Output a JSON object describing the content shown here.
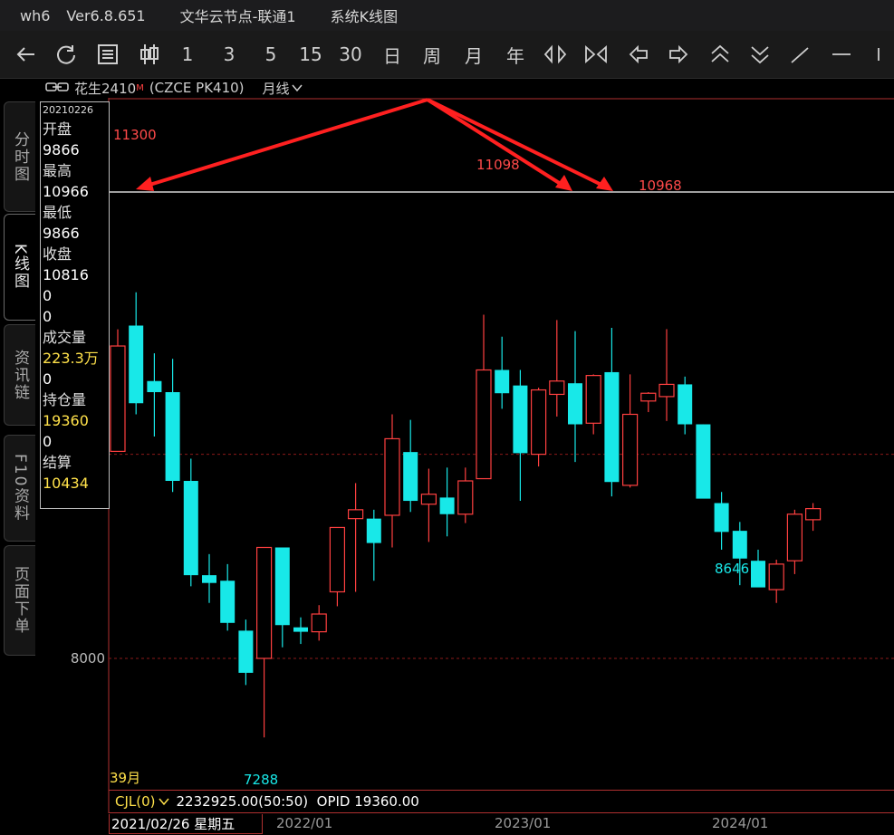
{
  "titlebar": {
    "app": "wh6",
    "version": "Ver6.8.651",
    "server": "文华云节点-联通1",
    "window": "系统K线图"
  },
  "toolbar": {
    "numbers": [
      "1",
      "3",
      "5",
      "15",
      "30"
    ],
    "periods": [
      "日",
      "周",
      "月",
      "年"
    ]
  },
  "instrument": {
    "name": "花生2410",
    "badge": "M",
    "code": "(CZCE PK410)",
    "period": "月线"
  },
  "side_tabs": [
    "分时图",
    "K线图",
    "资讯链",
    "F10资料",
    "页面下单"
  ],
  "data_panel": {
    "date": "20210226",
    "open_label": "开盘",
    "open": "9866",
    "high_label": "最高",
    "high": "10966",
    "low_label": "最低",
    "low": "9866",
    "close_label": "收盘",
    "close": "10816",
    "extra1": "0",
    "extra2": "0",
    "volume_label": "成交量",
    "volume": "223.3万",
    "volume_extra": "0",
    "oi_label": "持仓量",
    "oi": "19360",
    "oi_extra": "0",
    "settle_label": "结算",
    "settle": "10434"
  },
  "chart_data": {
    "type": "candlestick",
    "y_axis_label": "8000",
    "annotations": [
      "11300",
      "11098",
      "10968",
      "8646",
      "7288"
    ],
    "bar_count_label": "39月",
    "x_ticks": [
      "2022/01",
      "2023/01",
      "2024/01"
    ],
    "colors": {
      "up": "#ff4040",
      "down": "#18e8e8",
      "grid": "#8b1a1a",
      "ref": "#ffffff"
    },
    "candles": [
      {
        "o": 9866,
        "h": 10966,
        "l": 9866,
        "c": 10816
      },
      {
        "o": 11000,
        "h": 11300,
        "l": 10200,
        "c": 10300
      },
      {
        "o": 10500,
        "h": 10750,
        "l": 10000,
        "c": 10400
      },
      {
        "o": 10400,
        "h": 10700,
        "l": 9500,
        "c": 9600
      },
      {
        "o": 9600,
        "h": 9800,
        "l": 8650,
        "c": 8750
      },
      {
        "o": 8750,
        "h": 8940,
        "l": 8500,
        "c": 8680
      },
      {
        "o": 8700,
        "h": 8850,
        "l": 8250,
        "c": 8320
      },
      {
        "o": 8250,
        "h": 8350,
        "l": 7760,
        "c": 7870
      },
      {
        "o": 8000,
        "h": 9000,
        "l": 7288,
        "c": 9000
      },
      {
        "o": 9000,
        "h": 9000,
        "l": 8100,
        "c": 8300
      },
      {
        "o": 8280,
        "h": 8370,
        "l": 8130,
        "c": 8240
      },
      {
        "o": 8240,
        "h": 8480,
        "l": 8160,
        "c": 8400
      },
      {
        "o": 8600,
        "h": 9180,
        "l": 8470,
        "c": 9180
      },
      {
        "o": 9260,
        "h": 9580,
        "l": 8600,
        "c": 9340
      },
      {
        "o": 9260,
        "h": 9340,
        "l": 8700,
        "c": 9040
      },
      {
        "o": 9290,
        "h": 10200,
        "l": 9000,
        "c": 9980
      },
      {
        "o": 9860,
        "h": 10150,
        "l": 9320,
        "c": 9420
      },
      {
        "o": 9390,
        "h": 9710,
        "l": 9050,
        "c": 9480
      },
      {
        "o": 9450,
        "h": 9720,
        "l": 9100,
        "c": 9300
      },
      {
        "o": 9300,
        "h": 9720,
        "l": 9220,
        "c": 9600
      },
      {
        "o": 9620,
        "h": 11098,
        "l": 9620,
        "c": 10600
      },
      {
        "o": 10600,
        "h": 10900,
        "l": 10250,
        "c": 10390
      },
      {
        "o": 10460,
        "h": 10600,
        "l": 9420,
        "c": 9850
      },
      {
        "o": 9840,
        "h": 10440,
        "l": 9730,
        "c": 10420
      },
      {
        "o": 10380,
        "h": 11050,
        "l": 10180,
        "c": 10500
      },
      {
        "o": 10480,
        "h": 10950,
        "l": 9770,
        "c": 10110
      },
      {
        "o": 10120,
        "h": 10560,
        "l": 10020,
        "c": 10550
      },
      {
        "o": 10580,
        "h": 10980,
        "l": 9460,
        "c": 9590
      },
      {
        "o": 9560,
        "h": 10560,
        "l": 9540,
        "c": 10200
      },
      {
        "o": 10320,
        "h": 10400,
        "l": 10220,
        "c": 10390
      },
      {
        "o": 10360,
        "h": 10968,
        "l": 10140,
        "c": 10470
      },
      {
        "o": 10470,
        "h": 10540,
        "l": 10020,
        "c": 10110
      },
      {
        "o": 10110,
        "h": 10110,
        "l": 9450,
        "c": 9440
      },
      {
        "o": 9400,
        "h": 9500,
        "l": 8980,
        "c": 9140
      },
      {
        "o": 9150,
        "h": 9230,
        "l": 8660,
        "c": 8900
      },
      {
        "o": 8880,
        "h": 8980,
        "l": 8646,
        "c": 8640
      },
      {
        "o": 8620,
        "h": 8890,
        "l": 8500,
        "c": 8850
      },
      {
        "o": 8880,
        "h": 9340,
        "l": 8760,
        "c": 9300
      },
      {
        "o": 9250,
        "h": 9400,
        "l": 9150,
        "c": 9350
      }
    ]
  },
  "bottom": {
    "indicator": "CJL(0)",
    "values": "2232925.00(50:50)  OPID 19360.00",
    "current_date": "2021/02/26 星期五"
  }
}
